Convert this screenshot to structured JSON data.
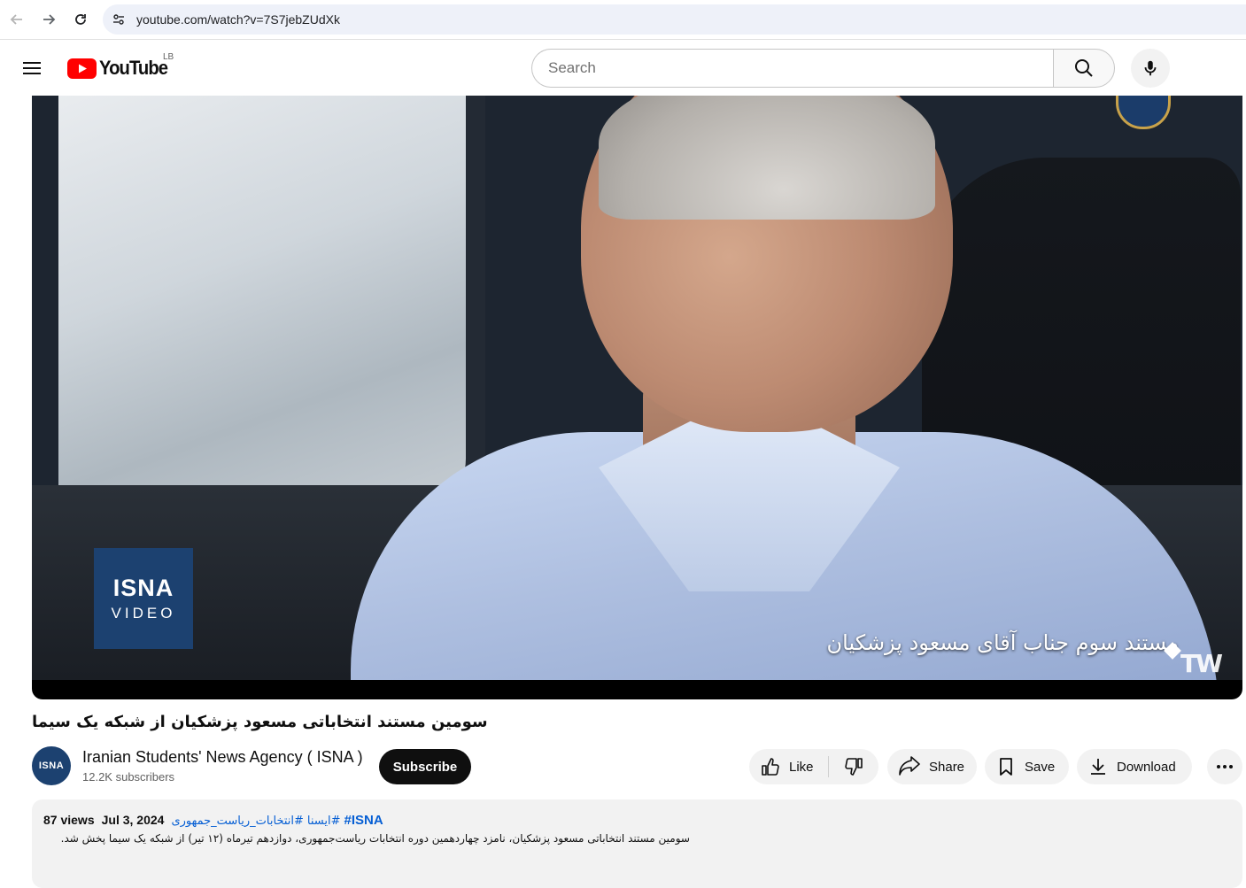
{
  "browser": {
    "url": "youtube.com/watch?v=7S7jebZUdXk"
  },
  "header": {
    "logo_text": "YouTube",
    "country_code": "LB",
    "search_placeholder": "Search"
  },
  "video": {
    "watermark_top": "ISNA",
    "watermark_bottom": "VIDEO",
    "caption": "مستند سوم جناب آقای مسعود پزشکیان",
    "corner_mark": "TW",
    "title": "سومین مستند انتخاباتی مسعود پزشکیان از شبکه یک سیما"
  },
  "channel": {
    "avatar_text": "ISNA",
    "name": "Iranian Students' News Agency ( ISNA )",
    "subscribers": "12.2K subscribers",
    "subscribe_label": "Subscribe"
  },
  "actions": {
    "like_label": "Like",
    "share_label": "Share",
    "save_label": "Save",
    "download_label": "Download"
  },
  "description": {
    "views": "87 views",
    "date": "Jul 3, 2024",
    "hashtag_1": "#انتخابات_ریاست_جمهوری",
    "hashtag_2": "#ایسنا",
    "hashtag_3": "#ISNA",
    "text": "سومین مستند انتخاباتی مسعود پزشکیان، نامزد چهاردهمین دوره انتخابات ریاست‌جمهوری، دوازدهم تیرماه (۱۲ تیر) از شبکه یک سیما پخش شد."
  },
  "colors": {
    "brand_red": "#ff0000",
    "link_blue": "#065fd4",
    "isna_blue": "#1c4170"
  }
}
